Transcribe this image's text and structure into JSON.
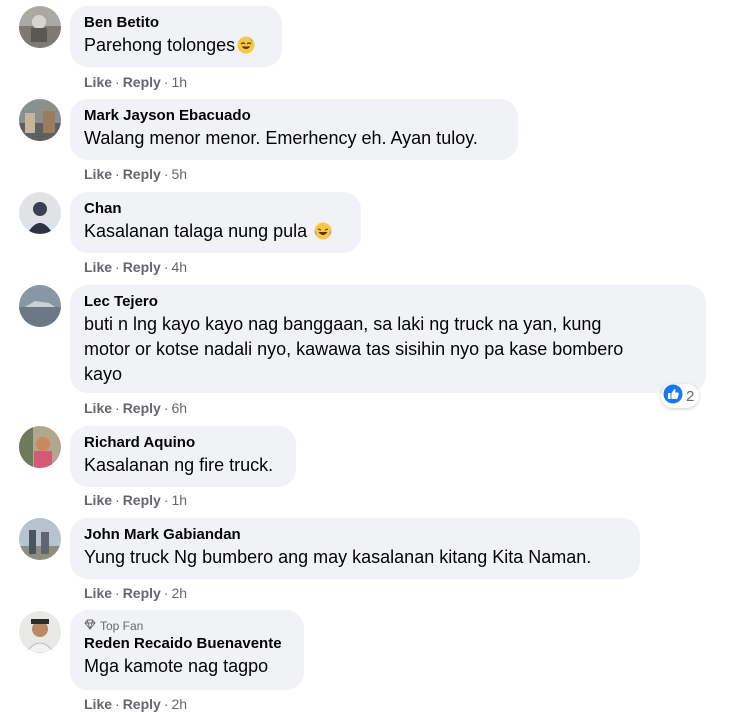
{
  "actions": {
    "like": "Like",
    "reply": "Reply",
    "separator": "·"
  },
  "comments": [
    {
      "author": "Ben Betito",
      "text": "Parehong tolonges",
      "time": "1h",
      "emoji": "grinning-sweat-emoji"
    },
    {
      "author": "Mark Jayson Ebacuado",
      "text": "Walang menor menor. Emerhency eh. Ayan tuloy.",
      "time": "5h"
    },
    {
      "author": "Chan",
      "text": "Kasalanan talaga nung pula",
      "time": "4h",
      "emoji": "tears-of-joy-emoji"
    },
    {
      "author": "Lec Tejero",
      "lines": [
        "buti n lng kayo kayo nag banggaan, sa laki ng truck na yan, kung",
        "motor or kotse nadali nyo, kawawa tas sisihin nyo pa kase bombero",
        "kayo"
      ],
      "time": "6h",
      "reaction_count": "2",
      "reaction_icon": "like-icon"
    },
    {
      "author": "Richard Aquino",
      "text": "Kasalanan ng fire truck.",
      "time": "1h"
    },
    {
      "author": "John Mark Gabiandan",
      "text": "Yung truck Ng bumbero ang may kasalanan kitang Kita Naman.",
      "time": "2h"
    },
    {
      "author": "Reden Recaido Buenavente",
      "badge": "Top Fan",
      "text": "Mga kamote nag tagpo",
      "time": "2h"
    }
  ]
}
